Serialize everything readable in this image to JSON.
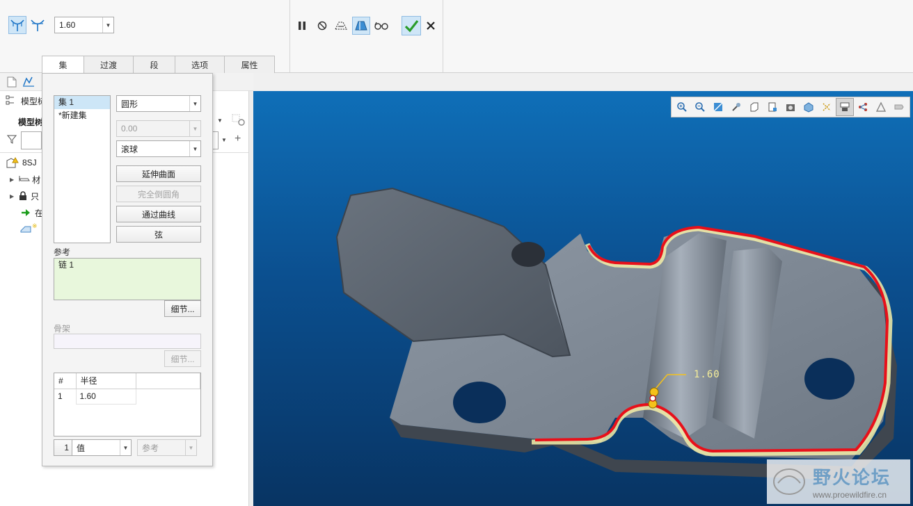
{
  "ribbon": {
    "radius_value": "1.60",
    "tabs": [
      "集",
      "过渡",
      "段",
      "选项",
      "属性"
    ],
    "active_tab": "集"
  },
  "panel": {
    "sets": [
      "集 1",
      "*新建集"
    ],
    "shape_select": "圆形",
    "disabled_value": "0.00",
    "method_select": "滚球",
    "buttons": {
      "extend": "延伸曲面",
      "full_round": "完全倒圆角",
      "through_curve": "通过曲线",
      "chord": "弦"
    },
    "reference_label": "参考",
    "reference_item": "链 1",
    "details_label": "细节...",
    "skeleton_label": "骨架",
    "skeleton_details_label": "细节...",
    "table": {
      "headers": [
        "#",
        "半径"
      ],
      "rows": [
        [
          "1",
          "1.60"
        ]
      ]
    },
    "bottom": {
      "index": "1",
      "value_select": "值",
      "ref_select": "参考"
    }
  },
  "model_tree": {
    "title": "模型树",
    "subtitle": "模型树",
    "items": [
      "8SJ",
      "材",
      "只",
      "在"
    ]
  },
  "viewport": {
    "dimension_label": "1.60",
    "watermark_title": "野火论坛",
    "watermark_url": "www.proewildfire.cn",
    "colors": {
      "edge_highlight": "#e8101a",
      "tangent_chain": "#f4eea8",
      "handle": "#f5c21a",
      "part": "#7a8592"
    }
  }
}
